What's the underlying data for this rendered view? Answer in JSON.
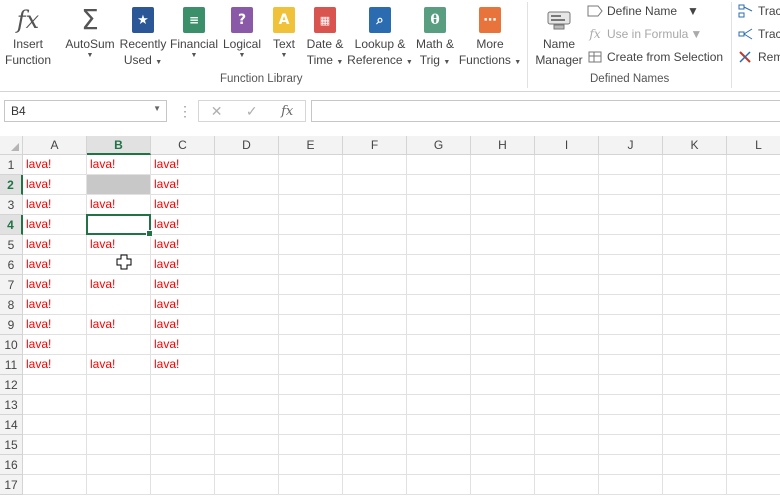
{
  "ribbon": {
    "function_library": {
      "group_label": "Function Library",
      "insert_function": [
        "Insert",
        "Function"
      ],
      "autosum": "AutoSum",
      "recently_used": [
        "Recently",
        "Used"
      ],
      "financial": "Financial",
      "logical": "Logical",
      "text": "Text",
      "date_time": [
        "Date &",
        "Time"
      ],
      "lookup_reference": [
        "Lookup &",
        "Reference"
      ],
      "math_trig": [
        "Math &",
        "Trig"
      ],
      "more_functions": [
        "More",
        "Functions"
      ]
    },
    "defined_names": {
      "group_label": "Defined Names",
      "name_manager": [
        "Name",
        "Manager"
      ],
      "define_name": "Define Name",
      "use_in_formula": "Use in Formula",
      "create_from_selection": "Create from Selection"
    },
    "formula_auditing": {
      "trace_precedents": "Trac",
      "trace_dependents": "Trac",
      "remove_arrows": "Rem"
    }
  },
  "formula_bar": {
    "name_box": "B4",
    "cancel_symbol": "✕",
    "enter_symbol": "✓",
    "fx_symbol": "fx",
    "formula": ""
  },
  "sheet": {
    "columns": [
      "A",
      "B",
      "C",
      "D",
      "E",
      "F",
      "G",
      "H",
      "I",
      "J",
      "K",
      "L"
    ],
    "rows": [
      "1",
      "2",
      "3",
      "4",
      "5",
      "6",
      "7",
      "8",
      "9",
      "10",
      "11",
      "12",
      "13",
      "14",
      "15",
      "16",
      "17"
    ],
    "selected_column": "B",
    "selected_rows": [
      "2",
      "4"
    ],
    "active_cell": "B4",
    "cells": [
      [
        "lava!",
        "lava!",
        "lava!"
      ],
      [
        "lava!",
        "",
        "lava!"
      ],
      [
        "lava!",
        "lava!",
        "lava!"
      ],
      [
        "lava!",
        "",
        "lava!"
      ],
      [
        "lava!",
        "lava!",
        "lava!"
      ],
      [
        "lava!",
        "",
        "lava!"
      ],
      [
        "lava!",
        "lava!",
        "lava!"
      ],
      [
        "lava!",
        "",
        "lava!"
      ],
      [
        "lava!",
        "lava!",
        "lava!"
      ],
      [
        "lava!",
        "",
        "lava!"
      ],
      [
        "lava!",
        "lava!",
        "lava!"
      ]
    ],
    "cell_text_color": "#ff0000",
    "selection_color": "#217346",
    "grey_fill_color": "#c8c8c8"
  }
}
